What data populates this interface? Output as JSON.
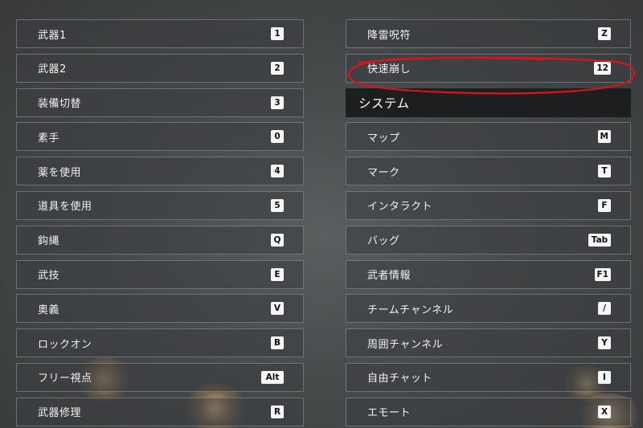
{
  "left_bindings": [
    {
      "label": "武器1",
      "key": "1"
    },
    {
      "label": "武器2",
      "key": "2"
    },
    {
      "label": "装備切替",
      "key": "3"
    },
    {
      "label": "素手",
      "key": "0"
    },
    {
      "label": "薬を使用",
      "key": "4"
    },
    {
      "label": "道具を使用",
      "key": "5"
    },
    {
      "label": "鈎縄",
      "key": "Q"
    },
    {
      "label": "武技",
      "key": "E"
    },
    {
      "label": "奥義",
      "key": "V"
    },
    {
      "label": "ロックオン",
      "key": "B"
    },
    {
      "label": "フリー視点",
      "key": "Alt"
    },
    {
      "label": "武器修理",
      "key": "R"
    }
  ],
  "right_top_bindings": [
    {
      "label": "降雷呪符",
      "key": "Z"
    },
    {
      "label": "快速崩し",
      "key": "12"
    }
  ],
  "system_section_title": "システム",
  "system_bindings": [
    {
      "label": "マップ",
      "key": "M"
    },
    {
      "label": "マーク",
      "key": "T"
    },
    {
      "label": "インタラクト",
      "key": "F"
    },
    {
      "label": "バッグ",
      "key": "Tab"
    },
    {
      "label": "武者情報",
      "key": "F1"
    },
    {
      "label": "チームチャンネル",
      "key": "/"
    },
    {
      "label": "周囲チャンネル",
      "key": "Y"
    },
    {
      "label": "自由チャット",
      "key": "I"
    },
    {
      "label": "エモート",
      "key": "X"
    }
  ],
  "colors": {
    "annotation_circle": "#d9141b",
    "key_background": "#f5f5f5",
    "section_header_background": "#1c1e1f"
  }
}
